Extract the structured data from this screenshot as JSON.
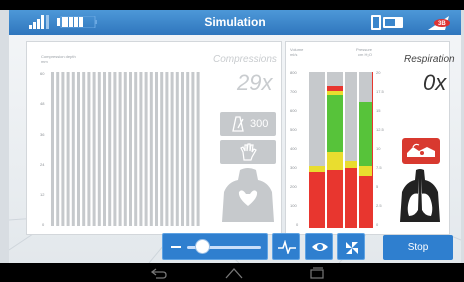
{
  "app": {
    "title": "Simulation"
  },
  "compressions": {
    "axis_title_line1": "Compression depth",
    "axis_title_line2": "mm",
    "ticks": [
      "60",
      "48",
      "36",
      "24",
      "12",
      "0"
    ],
    "title": "Compressions",
    "count": "29x",
    "rate_value": "300"
  },
  "respiration": {
    "volume_label_line1": "Volume",
    "volume_label_line2": "ml/s",
    "pressure_label_line1": "Pressure",
    "pressure_label_line2": "cm H₂O",
    "volume_ticks": [
      "800",
      "700",
      "600",
      "500",
      "400",
      "300",
      "200",
      "100",
      "0"
    ],
    "pressure_ticks": [
      "20",
      "17.5",
      "15",
      "12.5",
      "10",
      "7.5",
      "5",
      "2.5",
      "0"
    ],
    "title": "Respiration",
    "count": "0x"
  },
  "controls": {
    "volume_slider": 0.2,
    "stop_label": "Stop"
  },
  "colors": {
    "accent": "#2f7fcf",
    "title_bar": "#3a86cc",
    "bar_red": "#e8362f",
    "bar_yellow": "#e9dd2f",
    "bar_green": "#57c33a",
    "placeholder_gray": "#c6c9cc"
  },
  "icons": [
    "signal-bars-icon",
    "battery-icon",
    "metronome-icon",
    "hand-icon",
    "chest-icon",
    "face-mask-icon",
    "lungs-icon",
    "waveform-icon",
    "eye-icon",
    "fan-icon",
    "back-icon",
    "home-icon",
    "recents-icon"
  ]
}
